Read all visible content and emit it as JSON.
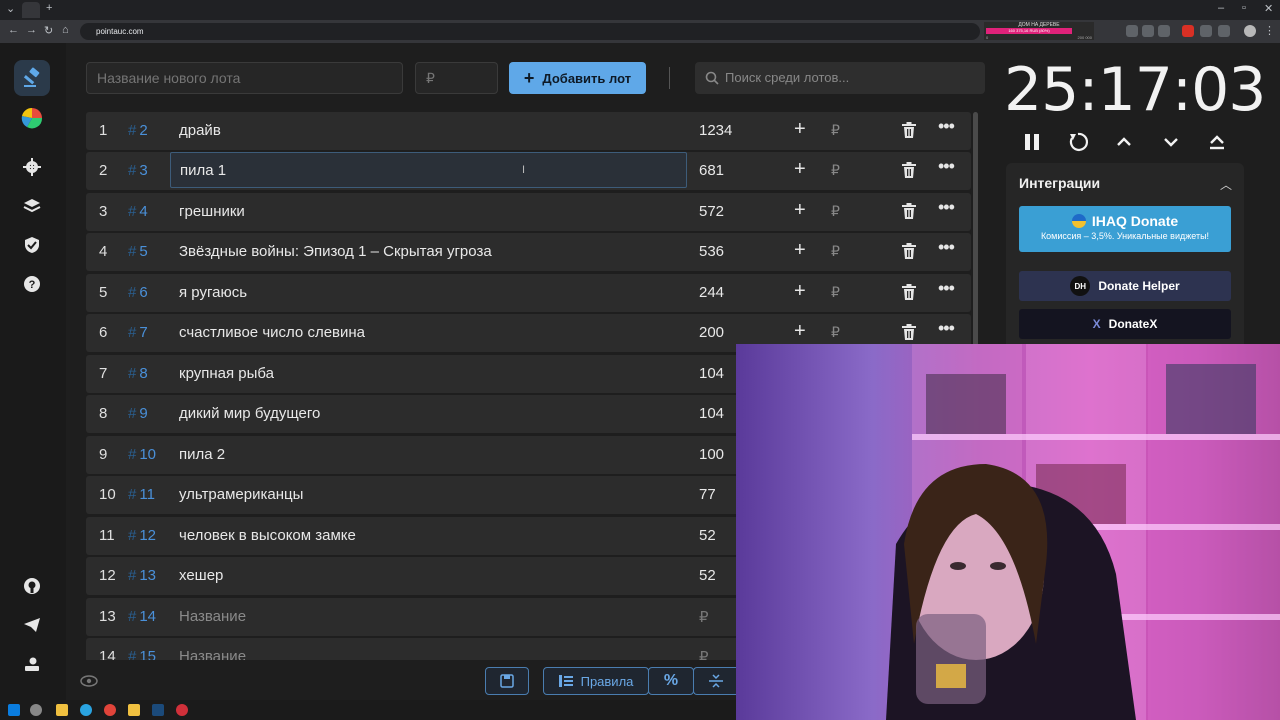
{
  "browser": {
    "url": "pointauc.com",
    "donation_bar": {
      "title": "ДОМ НА ДЕРЕВЕ",
      "amount": "160 375,16 RUB (80%)",
      "left": "0",
      "right": "200 000"
    }
  },
  "toolbar": {
    "lot_name_placeholder": "Название нового лота",
    "amount_placeholder": "₽",
    "add_button_label": "Добавить лот",
    "search_placeholder": "Поиск среди лотов..."
  },
  "lots": [
    {
      "index": "1",
      "id": "2",
      "name": "драйв",
      "amount": "1234"
    },
    {
      "index": "2",
      "id": "3",
      "name": "пила 1",
      "amount": "681"
    },
    {
      "index": "3",
      "id": "4",
      "name": "грешники",
      "amount": "572"
    },
    {
      "index": "4",
      "id": "5",
      "name": "Звёздные войны: Эпизод 1 – Скрытая угроза",
      "amount": "536"
    },
    {
      "index": "5",
      "id": "6",
      "name": "я ругаюсь",
      "amount": "244"
    },
    {
      "index": "6",
      "id": "7",
      "name": "счастливое число слевина",
      "amount": "200"
    },
    {
      "index": "7",
      "id": "8",
      "name": "крупная рыба",
      "amount": "104"
    },
    {
      "index": "8",
      "id": "9",
      "name": "дикий мир будущего",
      "amount": "104"
    },
    {
      "index": "9",
      "id": "10",
      "name": "пила 2",
      "amount": "100"
    },
    {
      "index": "10",
      "id": "11",
      "name": "ультрамериканцы",
      "amount": "77"
    },
    {
      "index": "11",
      "id": "12",
      "name": "человек в высоком замке",
      "amount": "52"
    },
    {
      "index": "12",
      "id": "13",
      "name": "хешер",
      "amount": "52"
    },
    {
      "index": "13",
      "id": "14",
      "name": "Название",
      "amount": "₽"
    },
    {
      "index": "14",
      "id": "15",
      "name": "Название",
      "amount": "₽"
    }
  ],
  "lot_hash": "#",
  "row_rub_symbol": "₽",
  "bottom": {
    "rules_label": "Правила",
    "percent_label": "%"
  },
  "timer": {
    "value": "25:17:03"
  },
  "integrations": {
    "title": "Интеграции",
    "ihaq": {
      "label": "IHAQ Donate",
      "sub": "Комиссия – 3,5%. Уникальные виджеты!"
    },
    "donate_helper": {
      "label": "Donate Helper",
      "logo": "DH"
    },
    "donatex": {
      "label": "DonateX",
      "logo": "X"
    }
  }
}
